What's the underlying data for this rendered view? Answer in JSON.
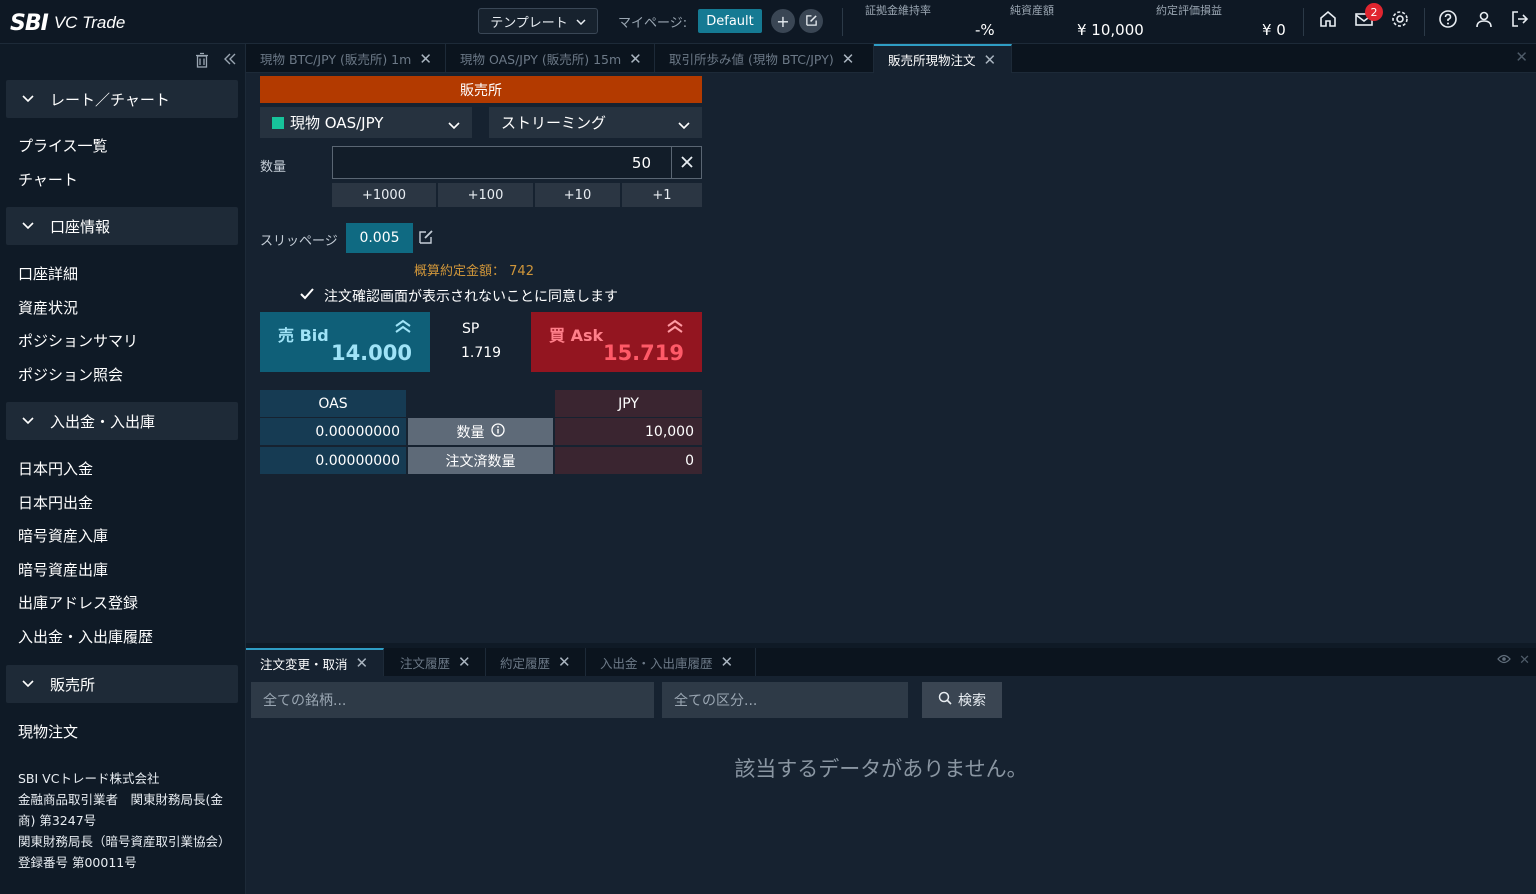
{
  "header": {
    "logo_sbi": "SBI",
    "logo_vctrade": "VC Trade",
    "template_label": "テンプレート",
    "mypage_label": "マイページ:",
    "mypage_default": "Default",
    "metrics": [
      {
        "label": "証拠金維持率",
        "value": "-%"
      },
      {
        "label": "純資産額",
        "value": "¥ 10,000"
      },
      {
        "label": "約定評価損益",
        "value": "¥ 0"
      }
    ],
    "mail_badge": "2"
  },
  "sidebar": {
    "sections": [
      {
        "label": "レート／チャート",
        "items": [
          "プライス一覧",
          "チャート"
        ]
      },
      {
        "label": "口座情報",
        "items": [
          "口座詳細",
          "資産状況",
          "ポジションサマリ",
          "ポジション照会"
        ]
      },
      {
        "label": "入出金・入出庫",
        "items": [
          "日本円入金",
          "日本円出金",
          "暗号資産入庫",
          "暗号資産出庫",
          "出庫アドレス登録",
          "入出金・入出庫履歴"
        ]
      },
      {
        "label": "販売所",
        "items": [
          "現物注文"
        ]
      }
    ],
    "company": [
      "SBI VCトレード株式会社",
      "金融商品取引業者　関東財務局長(金商) 第3247号",
      "関東財務局長（暗号資産取引業協会）登録番号 第00011号"
    ]
  },
  "tabs": [
    {
      "label": "現物 BTC/JPY (販売所) 1m"
    },
    {
      "label": "現物 OAS/JPY (販売所) 15m"
    },
    {
      "label": "取引所歩み値 (現物 BTC/JPY)"
    },
    {
      "label": "販売所現物注文"
    }
  ],
  "order": {
    "title": "販売所",
    "pair": "現物 OAS/JPY",
    "mode": "ストリーミング",
    "qty_label": "数量",
    "qty_value": "50",
    "increments": [
      "+1000",
      "+100",
      "+10",
      "+1"
    ],
    "slippage_label": "スリッページ",
    "slippage_value": "0.005",
    "estimate_label": "概算約定金額：",
    "estimate_value": "742",
    "confirm_text": "注文確認画面が表示されないことに同意します",
    "bid_label": "売 Bid",
    "bid_price": "14.000",
    "ask_label": "買 Ask",
    "ask_price": "15.719",
    "sp_label": "SP",
    "sp_value": "1.719",
    "balance": {
      "left_header": "OAS",
      "right_header": "JPY",
      "rows": [
        {
          "left": "0.00000000",
          "label": "数量",
          "right": "10,000"
        },
        {
          "left": "0.00000000",
          "label": "注文済数量",
          "right": "0"
        }
      ]
    }
  },
  "bottom": {
    "tabs": [
      "注文変更・取消",
      "注文履歴",
      "約定履歴",
      "入出金・入出庫履歴"
    ],
    "filter_symbol": "全ての銘柄...",
    "filter_type": "全ての区分...",
    "search_label": "検索",
    "empty_message": "該当するデータがありません。"
  },
  "colors": {
    "accent": "#157a93",
    "bid": "#0f5f78",
    "ask": "#931520",
    "title_bar": "#b33a00",
    "estimate": "#d0963a"
  }
}
